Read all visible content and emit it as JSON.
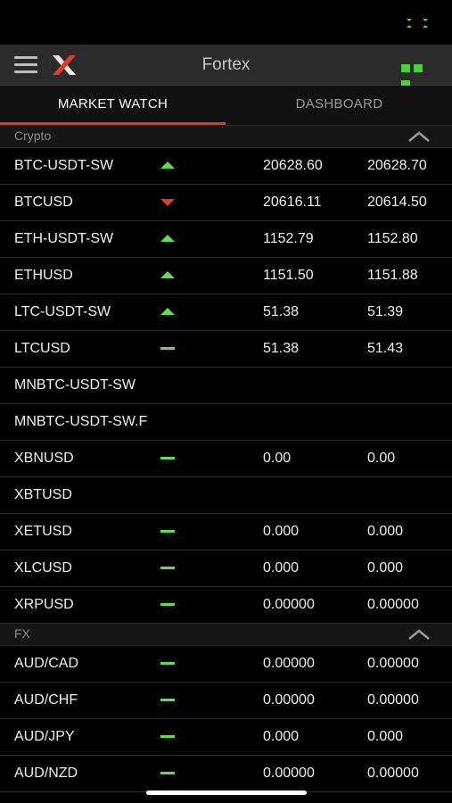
{
  "app": {
    "title": "Fortex"
  },
  "colors": {
    "accent": "#e03a2b",
    "up": "#5fe04a",
    "down": "#e53b2e",
    "background": "#000000"
  },
  "tabs": [
    {
      "label": "MARKET WATCH",
      "active": true
    },
    {
      "label": "DASHBOARD",
      "active": false
    }
  ],
  "sections": [
    {
      "label": "Crypto",
      "rows": [
        {
          "symbol": "BTC-USDT-SW",
          "trend": "up",
          "bid": "20628.60",
          "ask": "20628.70"
        },
        {
          "symbol": "BTCUSD",
          "trend": "down",
          "bid": "20616.11",
          "ask": "20614.50"
        },
        {
          "symbol": "ETH-USDT-SW",
          "trend": "up",
          "bid": "1152.79",
          "ask": "1152.80"
        },
        {
          "symbol": "ETHUSD",
          "trend": "up",
          "bid": "1151.50",
          "ask": "1151.88"
        },
        {
          "symbol": "LTC-USDT-SW",
          "trend": "up",
          "bid": "51.38",
          "ask": "51.39"
        },
        {
          "symbol": "LTCUSD",
          "trend": "flat",
          "bid": "51.38",
          "ask": "51.43"
        },
        {
          "symbol": "MNBTC-USDT-SW",
          "trend": "none",
          "bid": "",
          "ask": ""
        },
        {
          "symbol": "MNBTC-USDT-SW.F",
          "trend": "none",
          "bid": "",
          "ask": ""
        },
        {
          "symbol": "XBNUSD",
          "trend": "flat",
          "bid": "0.00",
          "ask": "0.00"
        },
        {
          "symbol": "XBTUSD",
          "trend": "none",
          "bid": "",
          "ask": ""
        },
        {
          "symbol": "XETUSD",
          "trend": "flat",
          "bid": "0.000",
          "ask": "0.000"
        },
        {
          "symbol": "XLCUSD",
          "trend": "flat",
          "bid": "0.000",
          "ask": "0.000"
        },
        {
          "symbol": "XRPUSD",
          "trend": "flat",
          "bid": "0.00000",
          "ask": "0.00000"
        }
      ]
    },
    {
      "label": "FX",
      "rows": [
        {
          "symbol": "AUD/CAD",
          "trend": "flat",
          "bid": "0.00000",
          "ask": "0.00000"
        },
        {
          "symbol": "AUD/CHF",
          "trend": "flat",
          "bid": "0.00000",
          "ask": "0.00000"
        },
        {
          "symbol": "AUD/JPY",
          "trend": "flat",
          "bid": "0.000",
          "ask": "0.000"
        },
        {
          "symbol": "AUD/NZD",
          "trend": "flat",
          "bid": "0.00000",
          "ask": "0.00000"
        }
      ]
    }
  ]
}
